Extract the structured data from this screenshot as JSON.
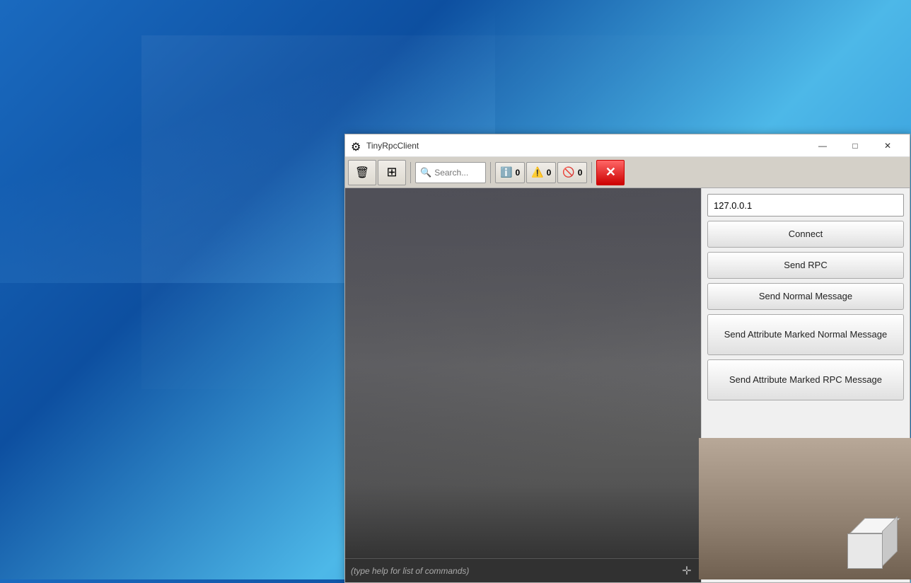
{
  "desktop": {
    "background": "blue gradient"
  },
  "window": {
    "title": "TinyRpcClient",
    "icon": "⚙",
    "controls": {
      "minimize": "—",
      "maximize": "□",
      "close": "✕"
    }
  },
  "toolbar": {
    "trash_icon": "🗑",
    "grid_icon": "⊞",
    "search_placeholder": "Search...",
    "badge_info_count": "0",
    "badge_warn_count": "0",
    "badge_error_count": "0",
    "close_label": "✕"
  },
  "right_panel": {
    "ip_value": "127.0.0.1",
    "ip_placeholder": "127.0.0.1",
    "connect_label": "Connect",
    "send_rpc_label": "Send RPC",
    "send_normal_label": "Send Normal Message",
    "send_attr_normal_label": "Send Attribute Marked Normal Message",
    "send_attr_rpc_label": "Send Attribute Marked RPC Message"
  },
  "canvas": {
    "input_placeholder": "(type help for list of commands)"
  }
}
